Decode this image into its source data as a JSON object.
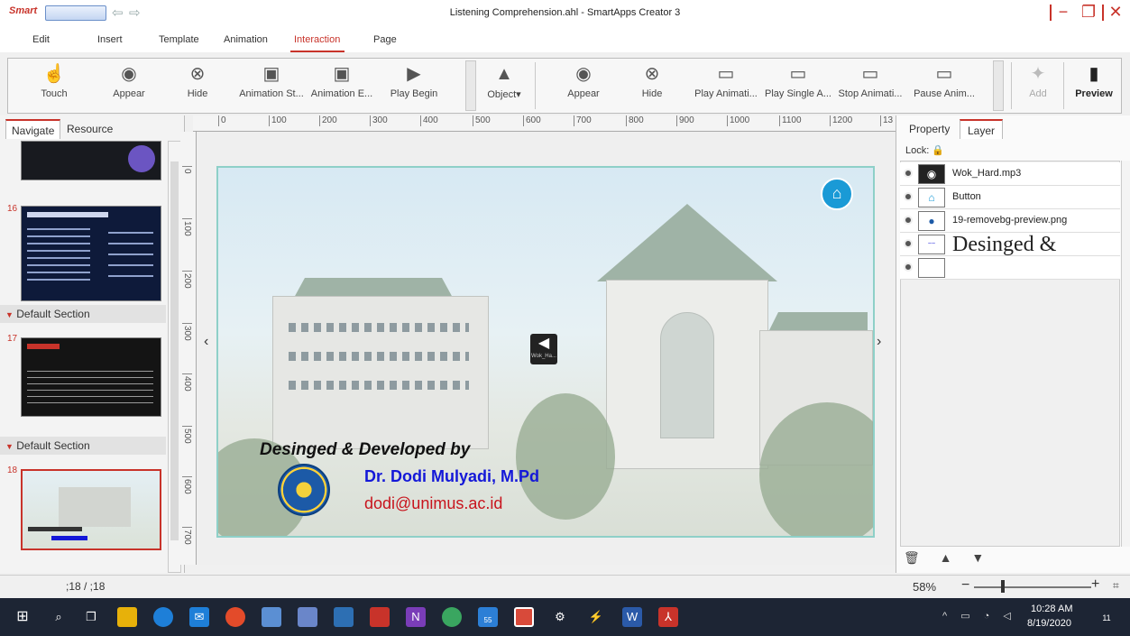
{
  "window": {
    "logo": "Smart",
    "title": "Listening Comprehension.ahl - SmartApps Creator 3"
  },
  "menu": [
    "Edit",
    "Insert",
    "Template",
    "Animation",
    "Interaction",
    "Page"
  ],
  "menu_active": "Interaction",
  "ribbon": {
    "left_group": [
      "Touch",
      "Appear",
      "Hide",
      "Animation St...",
      "Animation E...",
      "Play Begin"
    ],
    "object": "Object",
    "right_group": [
      "Appear",
      "Hide",
      "Play Animati...",
      "Play Single A...",
      "Stop Animati...",
      "Pause Anim..."
    ],
    "add": "Add",
    "preview": "Preview"
  },
  "left_panel": {
    "tabs": [
      "Navigate",
      "Resource"
    ],
    "slides": [
      {
        "num": "16"
      },
      {
        "num": "17"
      },
      {
        "num": "18"
      }
    ],
    "sections": [
      "Default Section",
      "Default Section"
    ]
  },
  "ruler": {
    "h": [
      "0",
      "100",
      "200",
      "300",
      "400",
      "500",
      "600",
      "700",
      "800",
      "900",
      "1000",
      "1100",
      "1200",
      "13"
    ],
    "v": [
      "0",
      "100",
      "200",
      "300",
      "400",
      "500",
      "600",
      "700"
    ]
  },
  "slide": {
    "audio_label": "Wok_Ha...",
    "credit_line1": "Desinged & Developed by",
    "credit_line2": "Dr. Dodi Mulyadi, M.Pd",
    "credit_line3": "dodi@unimus.ac.id"
  },
  "right_panel": {
    "tabs": [
      "Property",
      "Layer"
    ],
    "lock_label": "Lock:",
    "layers": [
      {
        "name": "Wok_Hard.mp3"
      },
      {
        "name": "Button"
      },
      {
        "name": "19-removebg-preview.png"
      },
      {
        "name": "Desinged &"
      },
      {
        "name": ""
      }
    ]
  },
  "status": {
    "page": ";18  /  ;18",
    "zoom": "58%"
  },
  "taskbar": {
    "badge": "55",
    "time": "10:28 AM",
    "date": "8/19/2020",
    "notif": "11"
  },
  "colors": {
    "accent": "#c8332a",
    "credit_blue": "#1418d8",
    "credit_red": "#c8141d",
    "home_button": "#1a9ad6",
    "taskbar": "#1d2534"
  }
}
